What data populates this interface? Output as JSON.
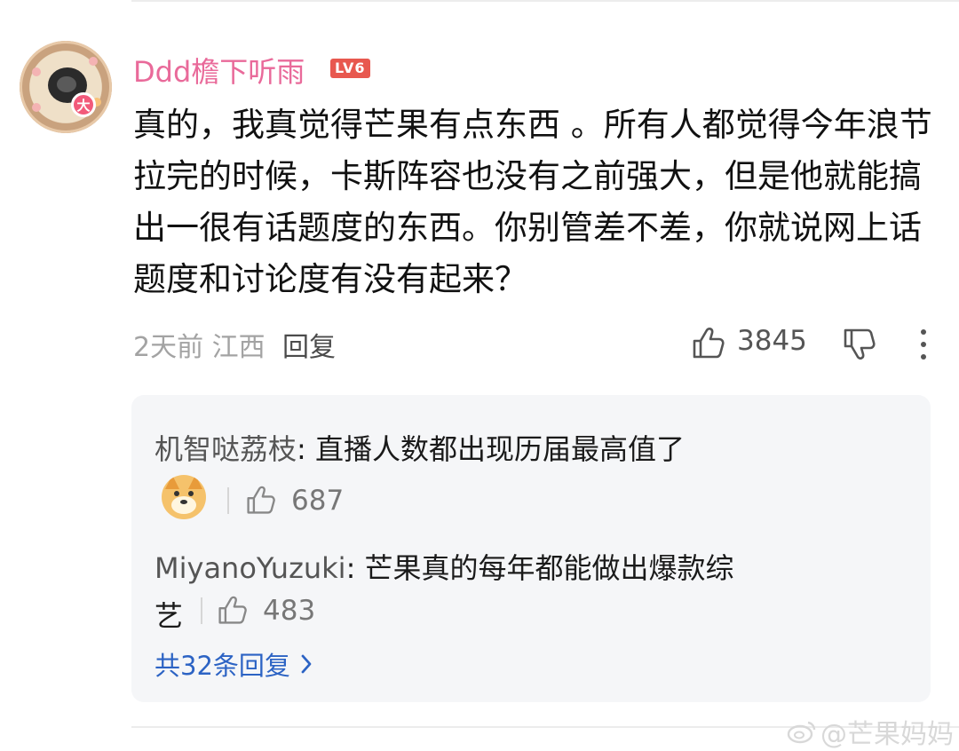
{
  "comment": {
    "username": "Ddd檐下听雨",
    "level": "LV6",
    "avatar_badge": "大",
    "text": "真的，我真觉得芒果有点东西 。所有人都觉得今年浪节拉完的时候，卡斯阵容也没有之前强大，但是他就能搞出一很有话题度的东西。你别管差不差，你就说网上话题度和讨论度有没有起来？",
    "time_location": "2天前 江西",
    "reply_label": "回复",
    "likes": "3845",
    "icons": [
      "thumbs-up-icon",
      "thumbs-down-icon",
      "more-vertical-icon"
    ]
  },
  "replies": {
    "items": [
      {
        "author": "机智哒荔枝",
        "text": "直播人数都出现历届最高值了",
        "likes": "687",
        "has_emoji": true
      },
      {
        "author": "MiyanoYuzuki",
        "text_line1": "芒果真的每年都能做出爆款综",
        "text_line2": "艺",
        "likes": "483"
      }
    ],
    "total_label": "共32条回复"
  },
  "watermark": "@芒果妈妈",
  "colors": {
    "username": "#e96a9a",
    "level_badge": "#e8584f",
    "link_blue": "#2c63c4",
    "reply_bg": "#f5f6f8"
  }
}
